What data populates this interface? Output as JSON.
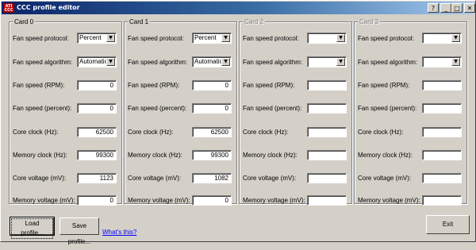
{
  "window": {
    "title": "CCC profile editor",
    "app_icon_text": "ATI\nCCC"
  },
  "labels": [
    "Fan speed protocol:",
    "Fan speed algorithm:",
    "Fan speed (RPM):",
    "Fan speed (percent):",
    "Core clock (Hz):",
    "Memory clock (Hz):",
    "Core voltage (mV):",
    "Memory voltage (mV):"
  ],
  "cards": [
    {
      "title": "Card 0",
      "enabled": true,
      "protocol": "Percent",
      "algorithm": "Automatic",
      "fan_rpm": "0",
      "fan_percent": "0",
      "core_clock": "62500",
      "memory_clock": "99300",
      "core_voltage": "1123",
      "memory_voltage": "0"
    },
    {
      "title": "Card 1",
      "enabled": true,
      "protocol": "Percent",
      "algorithm": "Automatic",
      "fan_rpm": "0",
      "fan_percent": "0",
      "core_clock": "62500",
      "memory_clock": "99300",
      "core_voltage": "1082",
      "memory_voltage": "0"
    },
    {
      "title": "Card 2",
      "enabled": false,
      "protocol": "",
      "algorithm": "",
      "fan_rpm": "",
      "fan_percent": "",
      "core_clock": "",
      "memory_clock": "",
      "core_voltage": "",
      "memory_voltage": ""
    },
    {
      "title": "Card 3",
      "enabled": false,
      "protocol": "",
      "algorithm": "",
      "fan_rpm": "",
      "fan_percent": "",
      "core_clock": "",
      "memory_clock": "",
      "core_voltage": "",
      "memory_voltage": ""
    }
  ],
  "buttons": {
    "load": "Load profile...",
    "save": "Save profile...",
    "whats_this": "What's this?",
    "exit": "Exit"
  },
  "colors": {
    "titlebar_start": "#0a246a",
    "titlebar_end": "#a6caf0",
    "face": "#d4d0c8",
    "link": "#0000ff"
  }
}
